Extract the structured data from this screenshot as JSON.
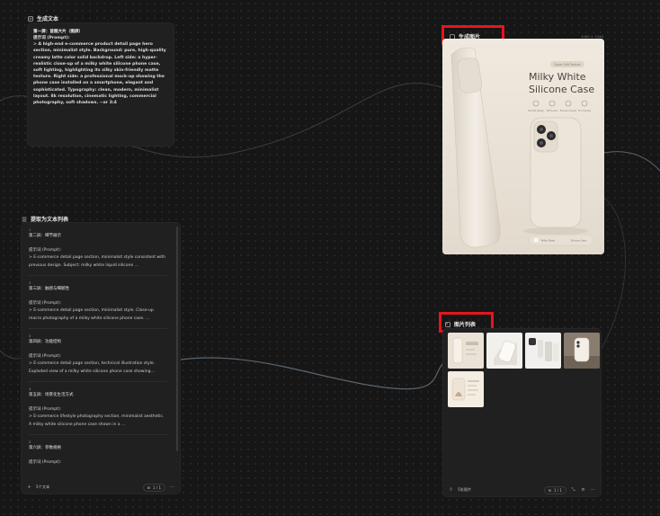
{
  "text_node": {
    "title": "生成文本",
    "heading": "第一屏：首图大片（图屏）",
    "prompt_label": "提示词 (Prompt):",
    "prompt": "> A high-end e-commerce product detail page hero section, minimalist style. Background: pure, high-quality creamy latte color solid backdrop. Left side: a hyper-realistic close-up of a milky white silicone phone case, soft lighting, highlighting its silky skin-friendly matte texture. Right side: a professional mock-up showing the phone case installed on a smartphone, elegant and sophisticated. Typography: clean, modern, minimalist layout. 8k resolution, cinematic lighting, commercial photography, soft shadows. --ar 3:4"
  },
  "list_node": {
    "title": "提取为文本列表",
    "items": [
      {
        "num": "1",
        "title": "第二屏：细节展示",
        "label": "提示词 (Prompt):",
        "body": "> E-commerce detail page section, minimalist style consistent with previous design. Subject: milky white liquid silicone ..."
      },
      {
        "num": "2",
        "title": "第三屏：触感与细腻性",
        "label": "提示词 (Prompt):",
        "body": "> E-commerce detail page section, minimalist style. Close-up macro photography of a milky white silicone phone case. ..."
      },
      {
        "num": "3",
        "title": "第四屏：功能结构",
        "label": "提示词 (Prompt):",
        "body": "> E-commerce detail page section, technical illustration style. Exploded view of a milky white silicone phone case showing..."
      },
      {
        "num": "4",
        "title": "第五屏：场景化生活方式",
        "label": "提示词 (Prompt):",
        "body": "> E-commerce lifestyle photography section, minimalist aesthetic. A milky white silicone phone case shown in a ..."
      },
      {
        "num": "5",
        "title": "第六屏：参数规格",
        "label": "提示词 (Prompt):",
        "body": ""
      }
    ],
    "footer_count": "5个文本",
    "pager": "1 / 1"
  },
  "image_node": {
    "title": "生成图片",
    "dimensions": "1080 × 1440",
    "pill_text": "Super Soft Texture",
    "product_title_line1": "Milky White",
    "product_title_line2": "Silicone Case",
    "features": [
      "Anti-fall design",
      "Soft & skin",
      "Precise cutouts",
      "Eco-friendly"
    ],
    "bottom_left": "Milky White",
    "bottom_right": "Silicone Case"
  },
  "gallery_node": {
    "title": "图片列表",
    "footer_count": "5张图片",
    "pager": "1 / 1"
  },
  "colors": {
    "background": "#161616",
    "card": "#202020",
    "highlight": "#e5161b",
    "cream": "#ece6dc",
    "wire": "#5a6670"
  }
}
